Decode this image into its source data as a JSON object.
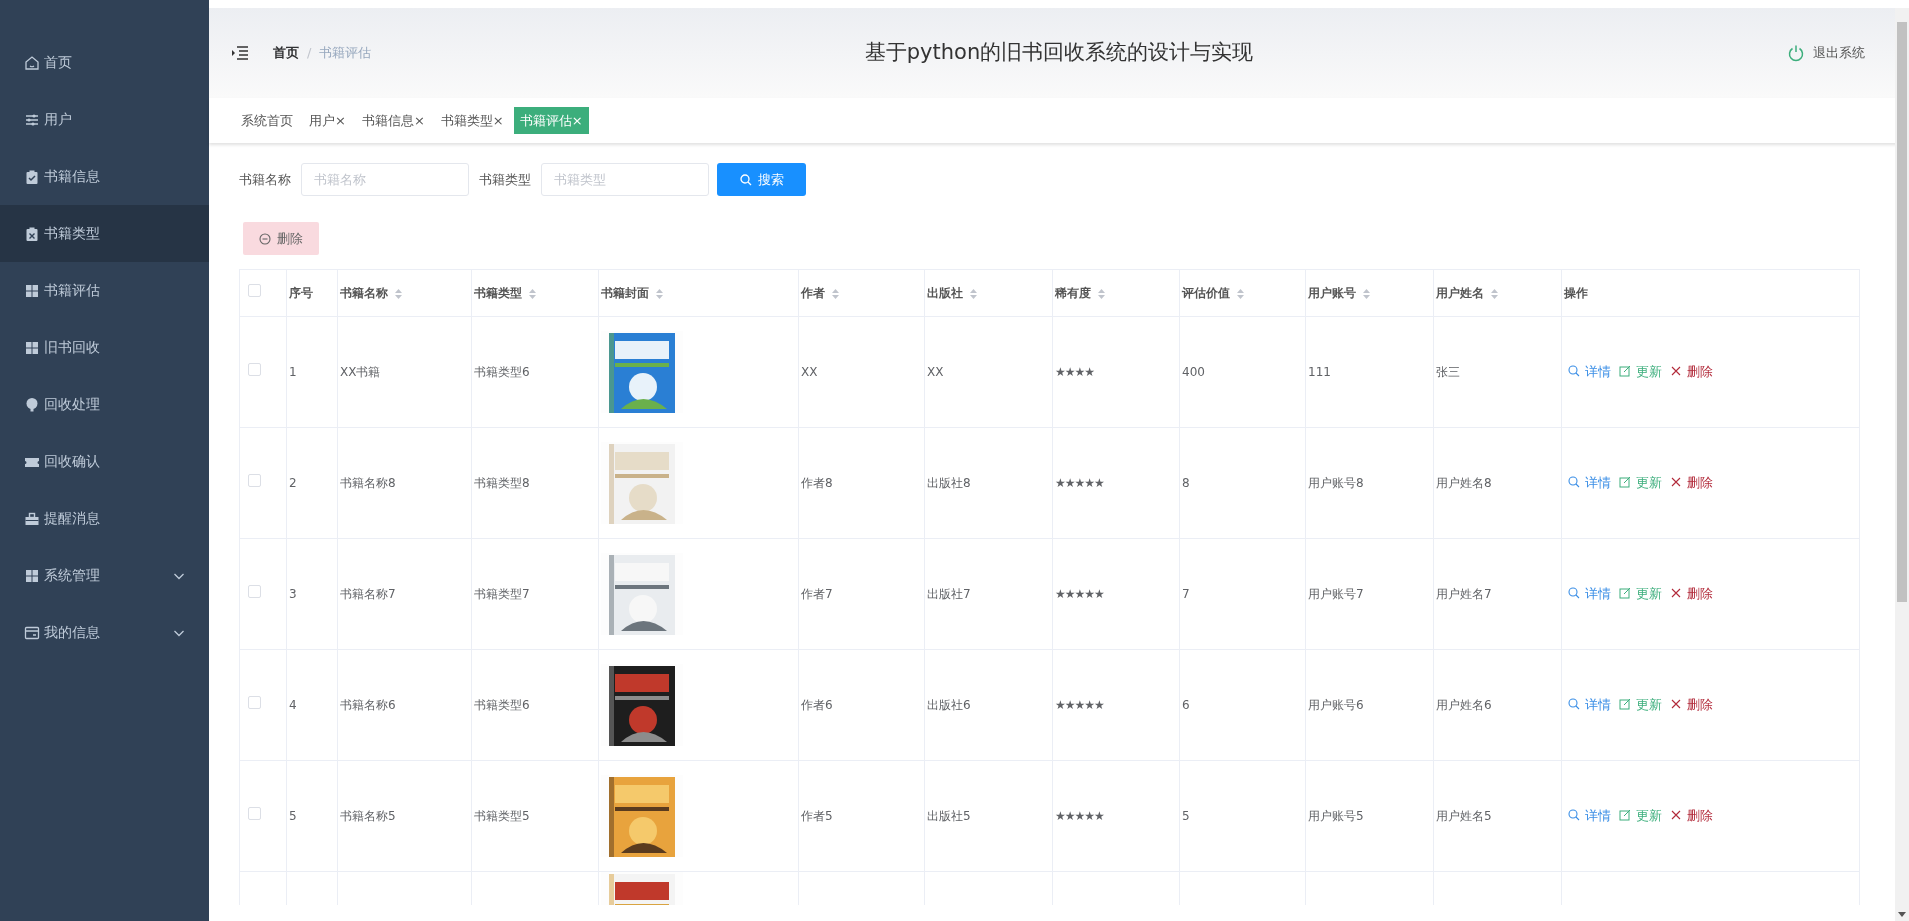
{
  "sidebar": {
    "items": [
      {
        "label": "首页",
        "highlighted": false,
        "expandable": false
      },
      {
        "label": "用户",
        "highlighted": false,
        "expandable": false
      },
      {
        "label": "书籍信息",
        "highlighted": false,
        "expandable": false
      },
      {
        "label": "书籍类型",
        "highlighted": true,
        "expandable": false
      },
      {
        "label": "书籍评估",
        "highlighted": false,
        "expandable": false
      },
      {
        "label": "旧书回收",
        "highlighted": false,
        "expandable": false
      },
      {
        "label": "回收处理",
        "highlighted": false,
        "expandable": false
      },
      {
        "label": "回收确认",
        "highlighted": false,
        "expandable": false
      },
      {
        "label": "提醒消息",
        "highlighted": false,
        "expandable": false
      },
      {
        "label": "系统管理",
        "highlighted": false,
        "expandable": true
      },
      {
        "label": "我的信息",
        "highlighted": false,
        "expandable": true
      }
    ]
  },
  "header": {
    "breadcrumb": [
      "首页",
      "书籍评估"
    ],
    "separator": "/",
    "title": "基于python的旧书回收系统的设计与实现",
    "logout": "退出系统"
  },
  "tabs": [
    {
      "label": "系统首页",
      "selected": false
    },
    {
      "label": "用户×",
      "selected": false
    },
    {
      "label": "书籍信息×",
      "selected": false
    },
    {
      "label": "书籍类型×",
      "selected": false
    },
    {
      "label": "书籍评估×",
      "selected": true
    }
  ],
  "search": {
    "fields": [
      {
        "label": "书籍名称",
        "placeholder": "书籍名称"
      },
      {
        "label": "书籍类型",
        "placeholder": "书籍类型"
      }
    ],
    "button": "搜索"
  },
  "delete_button": "删除",
  "table": {
    "select_all_checked": false,
    "columns": [
      {
        "label": "序号",
        "sortable": false
      },
      {
        "label": "书籍名称",
        "sortable": true
      },
      {
        "label": "书籍类型",
        "sortable": true
      },
      {
        "label": "书籍封面",
        "sortable": true
      },
      {
        "label": "作者",
        "sortable": true
      },
      {
        "label": "出版社",
        "sortable": true
      },
      {
        "label": "稀有度",
        "sortable": true
      },
      {
        "label": "评估价值",
        "sortable": true
      },
      {
        "label": "用户账号",
        "sortable": true
      },
      {
        "label": "用户姓名",
        "sortable": true
      },
      {
        "label": "操作",
        "sortable": false
      }
    ],
    "rows": [
      {
        "checked": false,
        "cells": [
          "1",
          "XX书籍",
          "书籍类型6",
          {
            "kind": "picture"
          },
          "XX",
          "XX",
          "★★★★",
          "400",
          "111",
          "张三"
        ],
        "actions": [
          "详情",
          "更新",
          "删除"
        ]
      },
      {
        "checked": false,
        "cells": [
          "2",
          "书籍名称8",
          "书籍类型8",
          {
            "kind": "picture"
          },
          "作者8",
          "出版社8",
          "★★★★★",
          "8",
          "用户账号8",
          "用户姓名8"
        ],
        "actions": [
          "详情",
          "更新",
          "删除"
        ]
      },
      {
        "checked": false,
        "cells": [
          "3",
          "书籍名称7",
          "书籍类型7",
          {
            "kind": "picture"
          },
          "作者7",
          "出版社7",
          "★★★★★",
          "7",
          "用户账号7",
          "用户姓名7"
        ],
        "actions": [
          "详情",
          "更新",
          "删除"
        ]
      },
      {
        "checked": false,
        "cells": [
          "4",
          "书籍名称6",
          "书籍类型6",
          {
            "kind": "picture"
          },
          "作者6",
          "出版社6",
          "★★★★★",
          "6",
          "用户账号6",
          "用户姓名6"
        ],
        "actions": [
          "详情",
          "更新",
          "删除"
        ]
      },
      {
        "checked": false,
        "cells": [
          "5",
          "书籍名称5",
          "书籍类型5",
          {
            "kind": "picture"
          },
          "作者5",
          "出版社5",
          "★★★★★",
          "5",
          "用户账号5",
          "用户姓名5"
        ],
        "actions": [
          "详情",
          "更新",
          "删除"
        ]
      },
      {
        "cells": [
          {
            "kind": "picture"
          }
        ]
      }
    ]
  }
}
